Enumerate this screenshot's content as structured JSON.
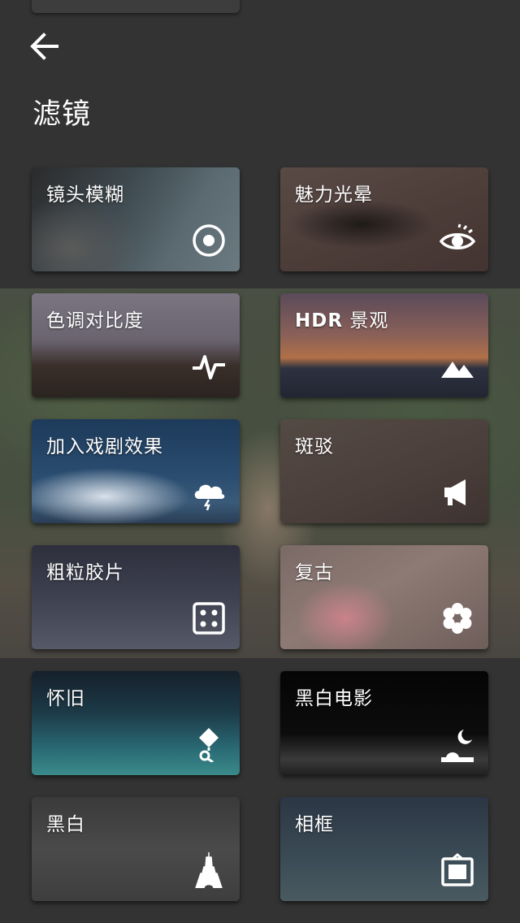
{
  "header": {
    "title": "滤镜",
    "back_icon": "arrow-left-icon"
  },
  "filters": [
    {
      "label": "镜头模糊",
      "icon": "target-icon"
    },
    {
      "label": "魅力光晕",
      "icon": "eye-icon"
    },
    {
      "label": "色调对比度",
      "icon": "pulse-icon"
    },
    {
      "label_bold": "HDR",
      "label_rest": " 景观",
      "icon": "mountain-icon"
    },
    {
      "label": "加入戏剧效果",
      "icon": "storm-cloud-icon"
    },
    {
      "label": "斑驳",
      "icon": "megaphone-icon"
    },
    {
      "label": "粗粒胶片",
      "icon": "dice-icon"
    },
    {
      "label": "复古",
      "icon": "flower-icon"
    },
    {
      "label": "怀旧",
      "icon": "kite-icon"
    },
    {
      "label": "黑白电影",
      "icon": "moon-landscape-icon"
    },
    {
      "label": "黑白",
      "icon": "eiffel-tower-icon"
    },
    {
      "label": "相框",
      "icon": "frame-icon"
    }
  ]
}
